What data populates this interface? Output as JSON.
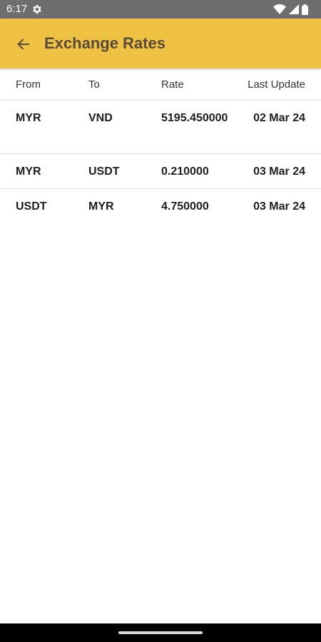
{
  "status_bar": {
    "time": "6:17",
    "icons": [
      "gear-icon",
      "wifi-icon",
      "signal-icon",
      "battery-icon"
    ]
  },
  "app_bar": {
    "title": "Exchange Rates",
    "back_icon": "arrow-left-icon",
    "background_color": "#f0c243"
  },
  "table": {
    "headers": {
      "from": "From",
      "to": "To",
      "rate": "Rate",
      "last_update": "Last Update"
    },
    "rows": [
      {
        "from": "MYR",
        "to": "VND",
        "rate": "5195.450000",
        "last_update": "02 Mar 24"
      },
      {
        "from": "MYR",
        "to": "USDT",
        "rate": "0.210000",
        "last_update": "03 Mar 24"
      },
      {
        "from": "USDT",
        "to": "MYR",
        "rate": "4.750000",
        "last_update": "03 Mar 24"
      }
    ]
  }
}
